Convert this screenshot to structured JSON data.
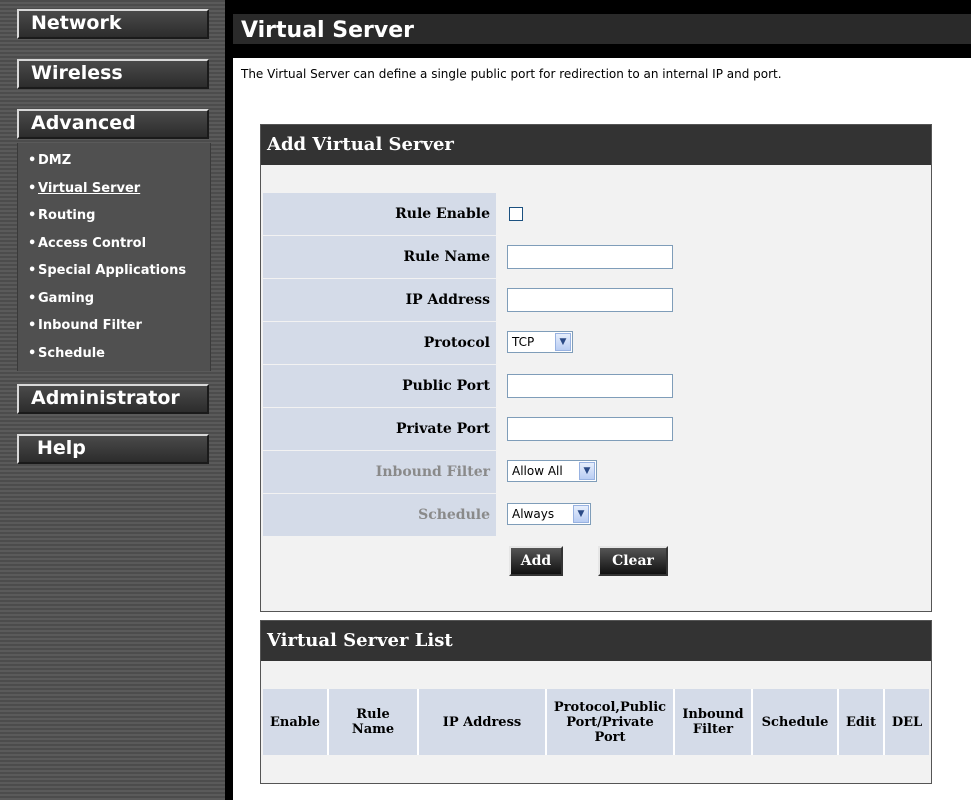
{
  "sidebar": {
    "network": "Network",
    "wireless": "Wireless",
    "advanced": "Advanced",
    "submenu": [
      {
        "label": "DMZ"
      },
      {
        "label": "Virtual Server"
      },
      {
        "label": "Routing"
      },
      {
        "label": "Access Control"
      },
      {
        "label": "Special Applications"
      },
      {
        "label": "Gaming"
      },
      {
        "label": "Inbound Filter"
      },
      {
        "label": "Schedule"
      }
    ],
    "administrator": "Administrator",
    "help": "Help"
  },
  "page": {
    "title": "Virtual Server",
    "description": "The Virtual Server can define a single public port for redirection to an internal IP and port."
  },
  "add_panel": {
    "title": "Add Virtual Server",
    "rule_enable_label": "Rule Enable",
    "rule_name_label": "Rule Name",
    "ip_address_label": "IP Address",
    "protocol_label": "Protocol",
    "protocol_value": "TCP",
    "public_port_label": "Public Port",
    "private_port_label": "Private Port",
    "inbound_filter_label": "Inbound Filter",
    "inbound_filter_value": "Allow All",
    "schedule_label": "Schedule",
    "schedule_value": "Always",
    "add_button": "Add",
    "clear_button": "Clear"
  },
  "list_panel": {
    "title": "Virtual Server List",
    "columns": {
      "enable": "Enable",
      "rule_name": "Rule Name",
      "ip_address": "IP Address",
      "protocol_ports": "Protocol,Public Port/Private Port",
      "inbound_filter": "Inbound Filter",
      "schedule": "Schedule",
      "edit": "Edit",
      "del": "DEL"
    }
  },
  "colors": {
    "label_bg": "#d4dbe8",
    "header_bg": "#333333",
    "disabled_text": "#8a8a8a"
  }
}
